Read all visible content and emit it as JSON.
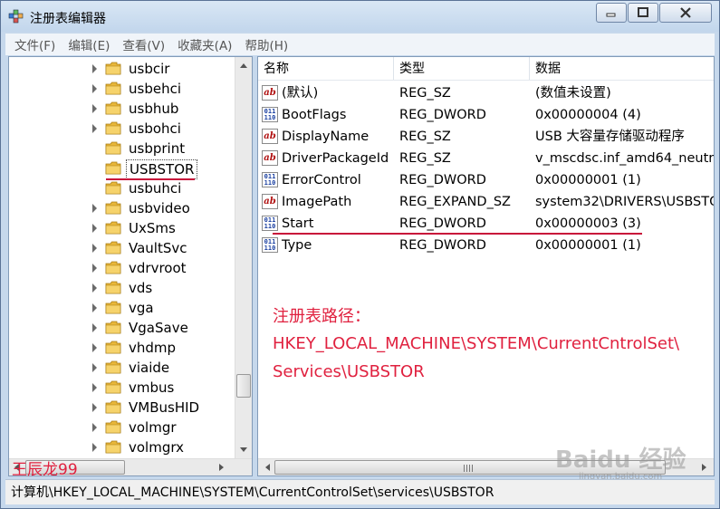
{
  "window": {
    "title": "注册表编辑器"
  },
  "menu": [
    "文件(F)",
    "编辑(E)",
    "查看(V)",
    "收藏夹(A)",
    "帮助(H)"
  ],
  "tree": {
    "items": [
      {
        "label": "usbcir",
        "expandable": true
      },
      {
        "label": "usbehci",
        "expandable": true
      },
      {
        "label": "usbhub",
        "expandable": true
      },
      {
        "label": "usbohci",
        "expandable": true
      },
      {
        "label": "usbprint",
        "expandable": false
      },
      {
        "label": "USBSTOR",
        "expandable": false,
        "selected": true
      },
      {
        "label": "usbuhci",
        "expandable": false
      },
      {
        "label": "usbvideo",
        "expandable": true
      },
      {
        "label": "UxSms",
        "expandable": true
      },
      {
        "label": "VaultSvc",
        "expandable": true
      },
      {
        "label": "vdrvroot",
        "expandable": true
      },
      {
        "label": "vds",
        "expandable": true
      },
      {
        "label": "vga",
        "expandable": true
      },
      {
        "label": "VgaSave",
        "expandable": true
      },
      {
        "label": "vhdmp",
        "expandable": true
      },
      {
        "label": "viaide",
        "expandable": true
      },
      {
        "label": "vmbus",
        "expandable": true
      },
      {
        "label": "VMBusHID",
        "expandable": true
      },
      {
        "label": "volmgr",
        "expandable": true
      },
      {
        "label": "volmgrx",
        "expandable": true
      }
    ]
  },
  "values": {
    "columns": {
      "name": "名称",
      "type": "类型",
      "data": "数据"
    },
    "rows": [
      {
        "icon": "sz",
        "name": "(默认)",
        "type": "REG_SZ",
        "data": "(数值未设置)"
      },
      {
        "icon": "dword",
        "name": "BootFlags",
        "type": "REG_DWORD",
        "data": "0x00000004 (4)"
      },
      {
        "icon": "sz",
        "name": "DisplayName",
        "type": "REG_SZ",
        "data": "USB 大容量存储驱动程序"
      },
      {
        "icon": "sz",
        "name": "DriverPackageId",
        "type": "REG_SZ",
        "data": "v_mscdsc.inf_amd64_neutr"
      },
      {
        "icon": "dword",
        "name": "ErrorControl",
        "type": "REG_DWORD",
        "data": "0x00000001 (1)"
      },
      {
        "icon": "sz",
        "name": "ImagePath",
        "type": "REG_EXPAND_SZ",
        "data": "system32\\DRIVERS\\USBSTO"
      },
      {
        "icon": "dword",
        "name": "Start",
        "type": "REG_DWORD",
        "data": "0x00000003 (3)"
      },
      {
        "icon": "dword",
        "name": "Type",
        "type": "REG_DWORD",
        "data": "0x00000001 (1)"
      }
    ]
  },
  "annotation": {
    "line1": "注册表路径：",
    "line2": "HKEY_LOCAL_MACHINE\\SYSTEM\\CurrentCntrolSet\\",
    "line3": "Services\\USBSTOR"
  },
  "watermark_name": "王辰龙99",
  "watermark_brand": "Baidu 经验",
  "watermark_url": "jingyan.baidu.com",
  "statusbar": "计算机\\HKEY_LOCAL_MACHINE\\SYSTEM\\CurrentControlSet\\services\\USBSTOR",
  "colors": {
    "annotation": "#e0213f",
    "underline": "#c8103a",
    "titlebar": "#c6d8ec"
  }
}
